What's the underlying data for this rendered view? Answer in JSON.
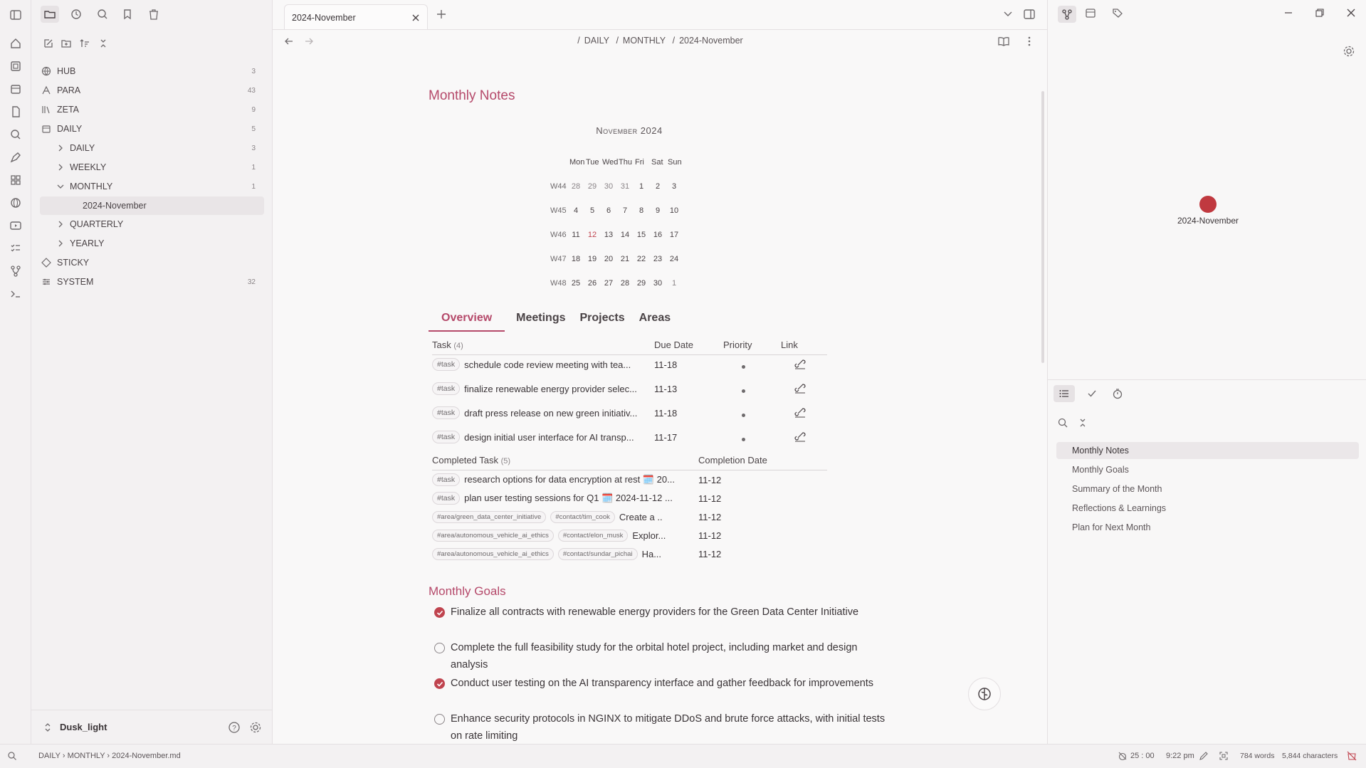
{
  "ribbon": {
    "icons": [
      "sidebar-toggle-icon",
      "home-icon",
      "note-icon",
      "calendar-icon",
      "document-search-icon",
      "search-icon",
      "pen-tool-icon",
      "dashboard-icon",
      "globe-icon",
      "video-icon",
      "checklist-icon",
      "git-branch-icon",
      "terminal-icon"
    ]
  },
  "sidebar": {
    "top_icons": [
      "folder-icon",
      "clock-icon",
      "search-icon",
      "bookmark-icon",
      "trash-icon"
    ],
    "tools": [
      "new-note-icon",
      "new-folder-icon",
      "sort-icon",
      "collapse-icon"
    ],
    "items": [
      {
        "label": "HUB",
        "count": "3",
        "icon": "globe-icon"
      },
      {
        "label": "PARA",
        "count": "43",
        "icon": "para-icon"
      },
      {
        "label": "ZETA",
        "count": "9",
        "icon": "library-icon"
      },
      {
        "label": "DAILY",
        "count": "5",
        "icon": "calendar-icon"
      },
      {
        "label": "DAILY",
        "count": "3"
      },
      {
        "label": "WEEKLY",
        "count": "1"
      },
      {
        "label": "MONTHLY",
        "count": "1"
      },
      {
        "label": "2024-November",
        "count": ""
      },
      {
        "label": "QUARTERLY",
        "count": ""
      },
      {
        "label": "YEARLY",
        "count": ""
      },
      {
        "label": "STICKY",
        "count": "",
        "icon": "sticky-icon"
      },
      {
        "label": "SYSTEM",
        "count": "32",
        "icon": "system-icon"
      }
    ],
    "vault_name": "Dusk_light"
  },
  "editor": {
    "tab_title": "2024-November",
    "breadcrumb": [
      "DAILY",
      "MONTHLY",
      "2024-November"
    ],
    "heading": "Monthly Notes",
    "calendar": {
      "title": "November 2024",
      "days": [
        "Mon",
        "Tue",
        "Wed",
        "Thu",
        "Fri",
        "Sat",
        "Sun"
      ],
      "weeks": [
        {
          "label": "W44",
          "days": [
            "28",
            "29",
            "30",
            "31",
            "1",
            "2",
            "3"
          ]
        },
        {
          "label": "W45",
          "days": [
            "4",
            "5",
            "6",
            "7",
            "8",
            "9",
            "10"
          ]
        },
        {
          "label": "W46",
          "days": [
            "11",
            "12",
            "13",
            "14",
            "15",
            "16",
            "17"
          ]
        },
        {
          "label": "W47",
          "days": [
            "18",
            "19",
            "20",
            "21",
            "22",
            "23",
            "24"
          ]
        },
        {
          "label": "W48",
          "days": [
            "25",
            "26",
            "27",
            "28",
            "29",
            "30",
            "1"
          ]
        }
      ]
    },
    "tabs": [
      "Overview",
      "Meetings",
      "Projects",
      "Areas"
    ],
    "tasks_header": {
      "task": "Task",
      "count": "(4)",
      "due": "Due Date",
      "priority": "Priority",
      "link": "Link"
    },
    "tasks": [
      {
        "tag": "#task",
        "text": "schedule code review meeting with tea...",
        "due": "11-18"
      },
      {
        "tag": "#task",
        "text": "finalize renewable energy provider selec...",
        "due": "11-13"
      },
      {
        "tag": "#task",
        "text": "draft press release on new green initiativ...",
        "due": "11-18"
      },
      {
        "tag": "#task",
        "text": "design initial user interface for AI transp...",
        "due": "11-17"
      }
    ],
    "completed_header": {
      "task": "Completed Task",
      "count": "(5)",
      "date": "Completion Date"
    },
    "completed": [
      {
        "tags": [
          "#task"
        ],
        "text": "research options for data encryption at rest 🗓️ 20...",
        "date": "11-12"
      },
      {
        "tags": [
          "#task"
        ],
        "text": "plan user testing sessions for Q1 🗓️ 2024-11-12 ...",
        "date": "11-12"
      },
      {
        "tags": [
          "#area/green_data_center_initiative",
          "#contact/tim_cook"
        ],
        "text": "Create a ...",
        "date": "11-12"
      },
      {
        "tags": [
          "#area/autonomous_vehicle_ai_ethics",
          "#contact/elon_musk"
        ],
        "text": "Explor...",
        "date": "11-12"
      },
      {
        "tags": [
          "#area/autonomous_vehicle_ai_ethics",
          "#contact/sundar_pichai"
        ],
        "text": "Ha...",
        "date": "11-12"
      }
    ],
    "goals_heading": "Monthly Goals",
    "goals": [
      {
        "done": true,
        "text": "Finalize all contracts with renewable energy providers for the Green Data Center Initiative"
      },
      {
        "done": false,
        "text": "Complete the full feasibility study for the orbital hotel project, including market and design analysis"
      },
      {
        "done": true,
        "text": "Conduct user testing on the AI transparency interface and gather feedback for improvements"
      },
      {
        "done": false,
        "text": "Enhance security protocols in NGINX to mitigate DDoS and brute force attacks, with initial tests on rate limiting"
      }
    ]
  },
  "right_panel": {
    "graph_node": "2024-November",
    "outline": [
      "Monthly Notes",
      "Monthly Goals",
      "Summary of the Month",
      "Reflections & Learnings",
      "Plan for Next Month"
    ]
  },
  "statusbar": {
    "path": [
      "DAILY",
      "MONTHLY",
      "2024-November.md"
    ],
    "timer": "25 : 00",
    "time": "9:22 pm",
    "words": "784 words",
    "chars": "5,844 characters"
  },
  "colors": {
    "accent": "#b5496a",
    "today": "#c0444f",
    "node": "#c0393f"
  }
}
